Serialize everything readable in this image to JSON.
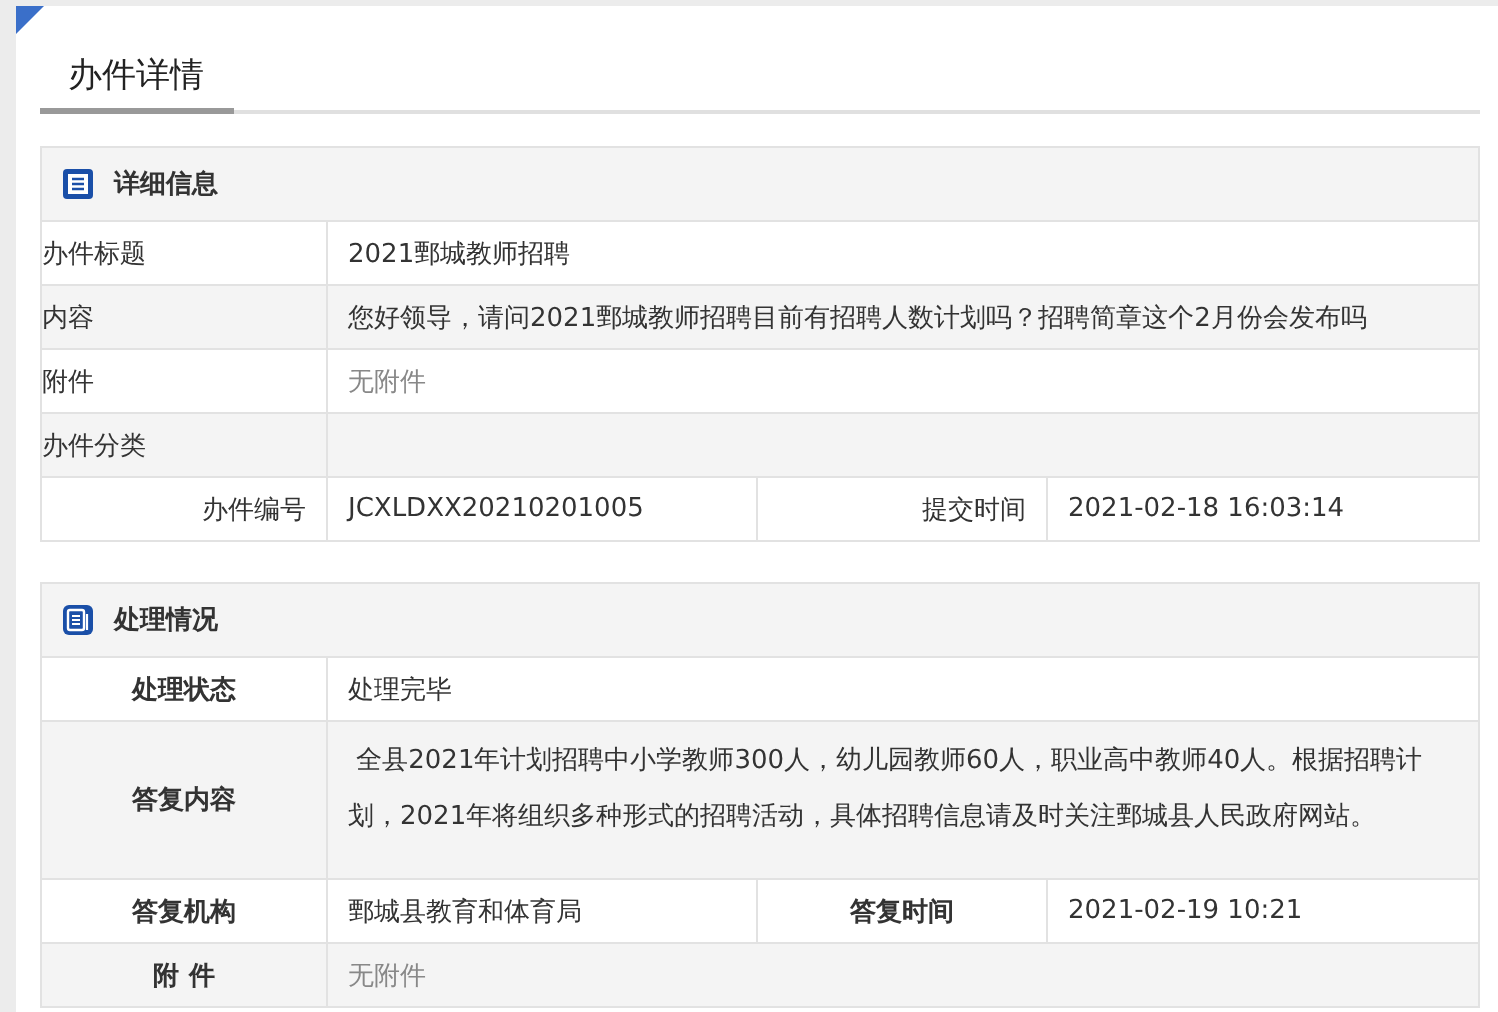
{
  "page": {
    "tab": "办件详情"
  },
  "sections": [
    {
      "kind": "detail",
      "title": "详细信息",
      "rows": [
        {
          "kind": "single",
          "label": "办件标题",
          "value": "2021鄄城教师招聘"
        },
        {
          "kind": "single",
          "label": "内容",
          "value": "您好领导，请问2021鄄城教师招聘目前有招聘人数计划吗？招聘简章这个2月份会发布吗"
        },
        {
          "kind": "note",
          "label": "附件",
          "value": "无附件"
        },
        {
          "kind": "single",
          "label": "办件分类"
        },
        {
          "kind": "pair",
          "fields": [
            {
              "label": "办件编号",
              "value": "JCXLDXX20210201005"
            },
            {
              "label": "提交时间",
              "value": "2021-02-18 16:03:14"
            }
          ]
        }
      ]
    },
    {
      "kind": "process",
      "title": "处理情况",
      "rows": [
        {
          "kind": "single",
          "label": "处理状态",
          "value": "处理完毕"
        },
        {
          "kind": "tall",
          "label": "答复内容",
          "value": " 全县2021年计划招聘中小学教师300人，幼儿园教师60人，职业高中教师40人。根据招聘计划，2021年将组织多种形式的招聘活动，具体招聘信息请及时关注鄄城县人民政府网站。"
        },
        {
          "kind": "pair",
          "fields": [
            {
              "label": "答复机构",
              "value": "鄄城县教育和体育局"
            },
            {
              "label": "答复时间",
              "value": "2021-02-19 10:21"
            }
          ]
        },
        {
          "kind": "note",
          "label": "附 件",
          "value": "无附件"
        }
      ]
    }
  ]
}
